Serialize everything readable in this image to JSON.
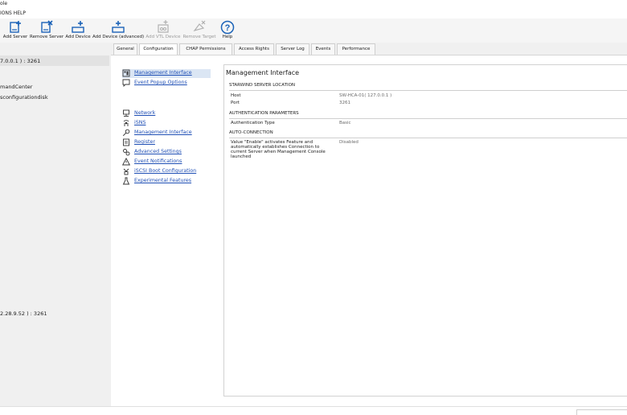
{
  "window": {
    "title_fragment": "ole"
  },
  "menu": {
    "visible_text": "IONS  HELP"
  },
  "toolbar": {
    "buttons": [
      {
        "label": "Add Server",
        "icon": "add-server-icon",
        "enabled": true
      },
      {
        "label": "Remove Server",
        "icon": "remove-server-icon",
        "enabled": true
      },
      {
        "label": "Add Device",
        "icon": "add-device-icon",
        "enabled": true
      },
      {
        "label": "Add Device (advanced)",
        "icon": "add-device-advanced-icon",
        "enabled": true
      },
      {
        "label": "Add VTL Device",
        "icon": "add-vtl-device-icon",
        "enabled": false
      },
      {
        "label": "Remove Target",
        "icon": "remove-target-icon",
        "enabled": false
      },
      {
        "label": "Help",
        "icon": "help-icon",
        "enabled": true
      }
    ]
  },
  "tree": {
    "items": [
      {
        "label": "7.0.0.1 ) : 3261",
        "selected": true
      },
      {
        "label": "mandCenter",
        "selected": false
      },
      {
        "label": "sconfigurationdisk",
        "selected": false
      },
      {
        "label": "2.28.9.52 ) : 3261",
        "selected": false
      }
    ]
  },
  "tabs": [
    {
      "label": "General",
      "active": false
    },
    {
      "label": "Configuration",
      "active": true
    },
    {
      "label": "CHAP Permissions",
      "active": false
    },
    {
      "label": "Access Rights",
      "active": false
    },
    {
      "label": "Server Log",
      "active": false
    },
    {
      "label": "Events",
      "active": false
    },
    {
      "label": "Performance",
      "active": false
    }
  ],
  "nav": {
    "group1": [
      {
        "label": "Management Interface",
        "icon": "management-interface-icon",
        "selected": true
      },
      {
        "label": "Event Popup Options",
        "icon": "event-popup-icon",
        "selected": false
      }
    ],
    "group2": [
      {
        "label": "Network",
        "icon": "network-icon"
      },
      {
        "label": "iSNS",
        "icon": "isns-icon"
      },
      {
        "label": "Management Interface",
        "icon": "key-icon"
      },
      {
        "label": "Register",
        "icon": "register-icon"
      },
      {
        "label": "Advanced Settings",
        "icon": "advanced-settings-icon"
      },
      {
        "label": "Event Notifications",
        "icon": "warning-icon"
      },
      {
        "label": "iSCSI Boot Configuration",
        "icon": "boot-icon"
      },
      {
        "label": "Experimental Features",
        "icon": "flask-icon"
      }
    ]
  },
  "detail": {
    "title": "Management Interface",
    "sections": {
      "location": {
        "header": "STARWIND SERVER LOCATION",
        "host_label": "Host",
        "host_value": "SW-HCA-01( 127.0.0.1 )",
        "port_label": "Port",
        "port_value": "3261"
      },
      "auth": {
        "header": "AUTHENTICATION PARAMETERS",
        "type_label": "Authentication Type",
        "type_value": "Basic"
      },
      "auto": {
        "header": "AUTO-CONNECTION",
        "desc_line1": "Value \"Enable\" activates Feature and",
        "desc_line2": "automatically establishes Connection to",
        "desc_line3": "current Server when Management Console",
        "desc_line4": "launched",
        "value": "Disabled"
      }
    }
  },
  "colors": {
    "link": "#1f4fb5",
    "toolbar_icon": "#1c63b8",
    "selection": "#dbe6f4",
    "disabled": "#9a9a9a"
  }
}
